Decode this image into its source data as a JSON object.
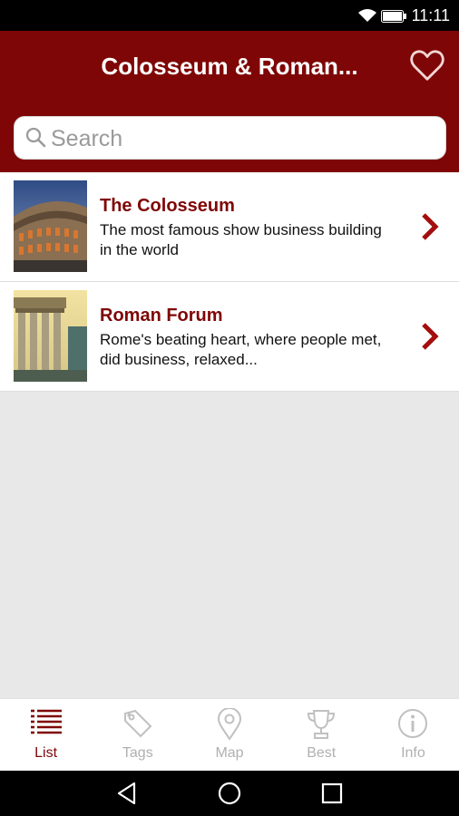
{
  "status": {
    "time": "11:11"
  },
  "app": {
    "title": "Colosseum & Roman..."
  },
  "search": {
    "placeholder": "Search",
    "value": ""
  },
  "items": [
    {
      "title": "The Colosseum",
      "description": "The most famous show business building in the world"
    },
    {
      "title": "Roman Forum",
      "description": "Rome's beating heart, where people met, did business, relaxed..."
    }
  ],
  "nav": {
    "tabs": [
      {
        "label": "List",
        "icon": "list-icon",
        "active": true
      },
      {
        "label": "Tags",
        "icon": "tag-icon",
        "active": false
      },
      {
        "label": "Map",
        "icon": "map-pin-icon",
        "active": false
      },
      {
        "label": "Best",
        "icon": "trophy-icon",
        "active": false
      },
      {
        "label": "Info",
        "icon": "info-icon",
        "active": false
      }
    ]
  },
  "colors": {
    "primary": "#7f0606",
    "background": "#e8e8e8",
    "inactive": "#b0b0b0"
  }
}
